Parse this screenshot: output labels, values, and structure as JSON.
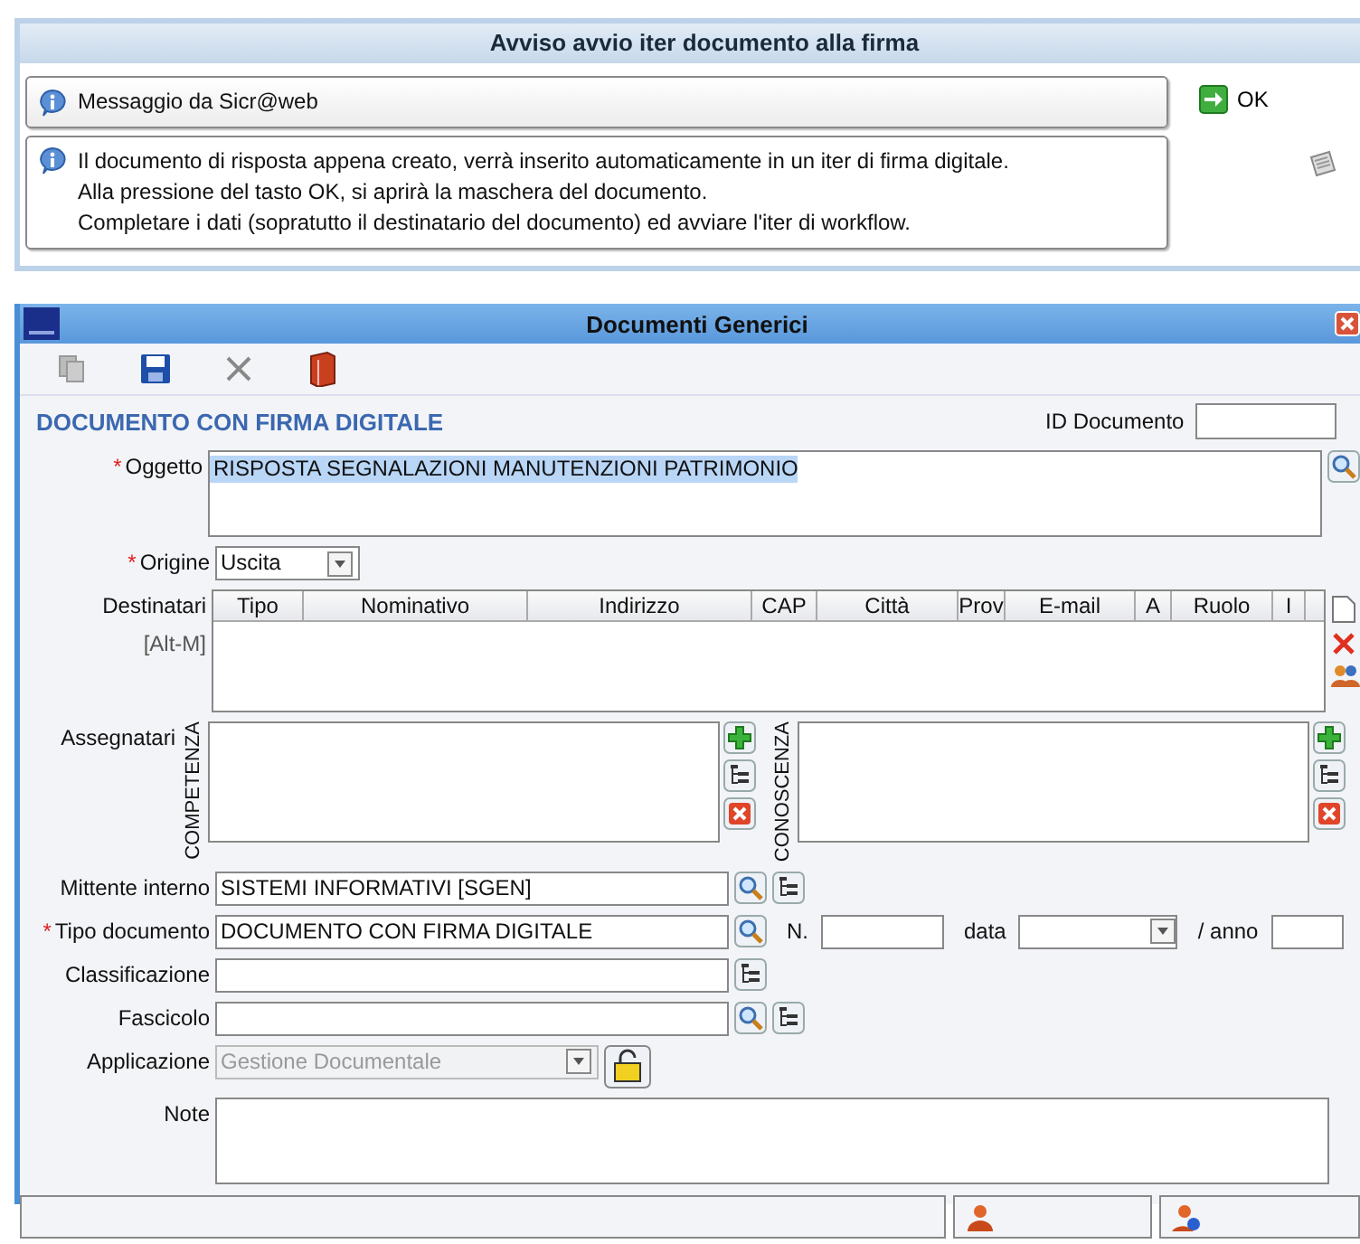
{
  "dialog": {
    "title": "Avviso avvio iter documento alla firma",
    "header_message": "Messaggio da Sicr@web",
    "body_lines": [
      "Il documento di risposta appena creato, verrà inserito automaticamente in un iter di firma digitale.",
      "Alla pressione del tasto OK, si aprirà la maschera del documento.",
      "Completare i dati (sopratutto il destinatario del documento) ed avviare l'iter di workflow."
    ],
    "ok_button": "OK"
  },
  "window": {
    "title": "Documenti Generici"
  },
  "form": {
    "heading": "DOCUMENTO CON FIRMA DIGITALE",
    "id_label": "ID Documento",
    "subject": {
      "required_mark": "*",
      "label": "Oggetto",
      "value": "RISPOSTA SEGNALAZIONI MANUTENZIONI PATRIMONIO",
      "selected": true
    },
    "origin": {
      "required_mark": "*",
      "label": "Origine",
      "value": "Uscita"
    },
    "recipients": {
      "label": "Destinatari",
      "shortcut": "[Alt-M]",
      "columns": [
        "Tipo",
        "Nominativo",
        "Indirizzo",
        "CAP",
        "Città",
        "Prov",
        "E-mail",
        "A",
        "Ruolo",
        "I"
      ]
    },
    "assignees": {
      "label": "Assegnatari",
      "panels": [
        {
          "caption": "COMPETENZA"
        },
        {
          "caption": "CONOSCENZA"
        }
      ]
    },
    "sender": {
      "label": "Mittente interno",
      "value": "SISTEMI INFORMATIVI [SGEN]"
    },
    "doc_type": {
      "required_mark": "*",
      "label": "Tipo documento",
      "value": "DOCUMENTO CON FIRMA DIGITALE",
      "number_label": "N.",
      "date_label": "data",
      "year_label": "/ anno"
    },
    "classification": {
      "label": "Classificazione"
    },
    "folder": {
      "label": "Fascicolo"
    },
    "application": {
      "label": "Applicazione",
      "value": "Gestione Documentale",
      "disabled": true
    },
    "notes": {
      "label": "Note"
    }
  }
}
